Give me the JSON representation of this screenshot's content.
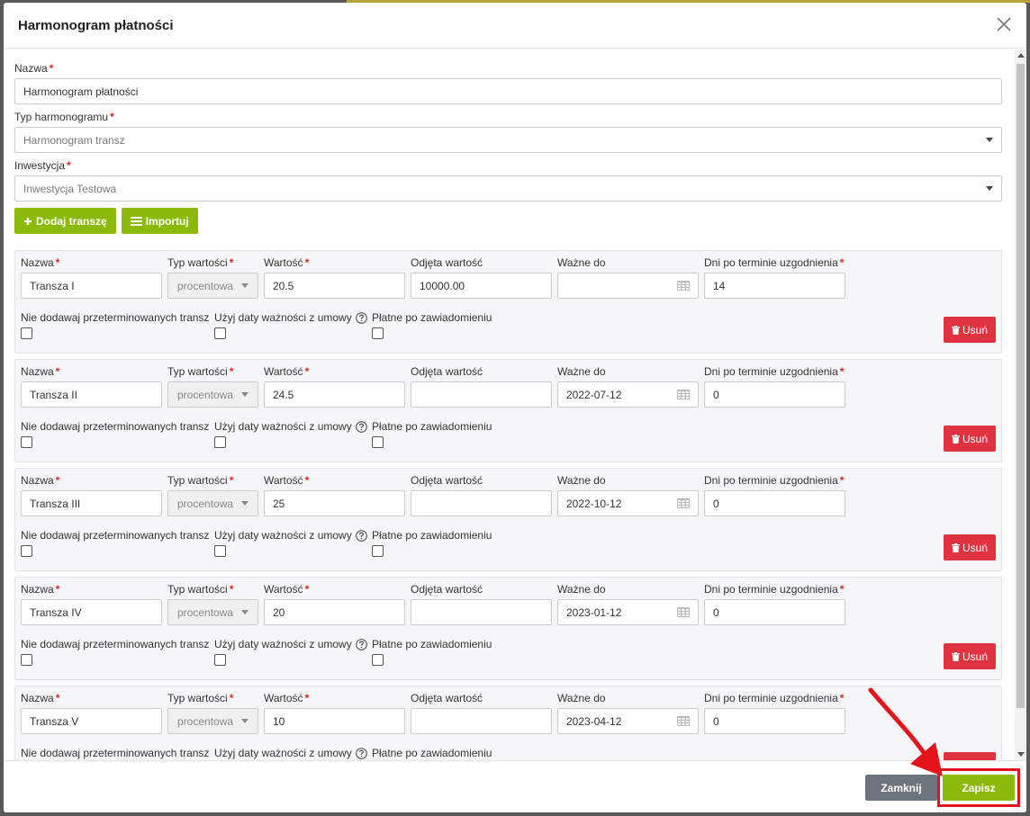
{
  "modal": {
    "title": "Harmonogram płatności",
    "fields": {
      "name_label": "Nazwa",
      "name_value": "Harmonogram płatności",
      "type_label": "Typ harmonogramu",
      "type_value": "Harmonogram transz",
      "investment_label": "Inwestycja",
      "investment_value": "Inwestycja Testowa"
    },
    "actions": {
      "add_label": "Dodaj transzę",
      "import_label": "Importuj"
    },
    "tranche_labels": {
      "name": "Nazwa",
      "value_type": "Typ wartości",
      "value": "Wartość",
      "deducted": "Odjęta wartość",
      "valid_to": "Ważne do",
      "days": "Dni po terminie uzgodnienia",
      "no_overdue": "Nie dodawaj przeterminowanych transz",
      "use_contract_date": "Użyj daty ważności z umowy",
      "notify": "Płatne po zawiadomieniu",
      "delete": "Usuń"
    },
    "tranches": [
      {
        "name": "Transza I",
        "value_type": "procentowa",
        "value": "20.5",
        "deducted": "10000.00",
        "valid_to": "",
        "days": "14"
      },
      {
        "name": "Transza II",
        "value_type": "procentowa",
        "value": "24.5",
        "deducted": "",
        "valid_to": "2022-07-12",
        "days": "0"
      },
      {
        "name": "Transza III",
        "value_type": "procentowa",
        "value": "25",
        "deducted": "",
        "valid_to": "2022-10-12",
        "days": "0"
      },
      {
        "name": "Transza IV",
        "value_type": "procentowa",
        "value": "20",
        "deducted": "",
        "valid_to": "2023-01-12",
        "days": "0"
      },
      {
        "name": "Transza V",
        "value_type": "procentowa",
        "value": "10",
        "deducted": "",
        "valid_to": "2023-04-12",
        "days": "0"
      }
    ],
    "footer": {
      "close_label": "Zamknij",
      "save_label": "Zapisz"
    }
  },
  "colors": {
    "accent_green": "#8cba0a",
    "danger_red": "#e0323f",
    "highlight_red": "#e3141c"
  }
}
